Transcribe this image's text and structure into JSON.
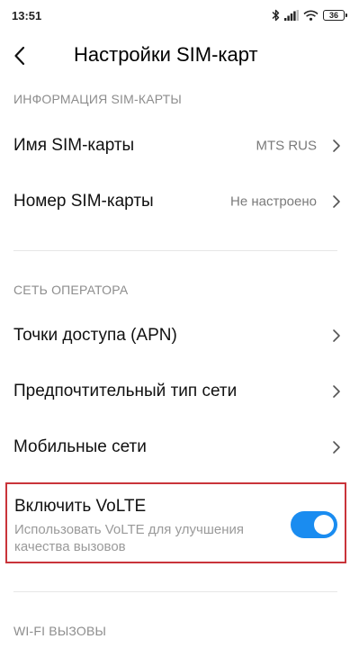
{
  "status_bar": {
    "time": "13:51",
    "battery_level": "36",
    "icons": [
      "bluetooth-icon",
      "signal-icon",
      "wifi-icon",
      "battery-icon"
    ]
  },
  "header": {
    "title": "Настройки SIM-карт",
    "back_icon": "back-arrow-icon"
  },
  "sections": {
    "sim_info": {
      "title": "ИНФОРМАЦИЯ SIM-КАРТЫ",
      "items": [
        {
          "label": "Имя SIM-карты",
          "value": "MTS RUS"
        },
        {
          "label": "Номер SIM-карты",
          "value": "Не настроено"
        }
      ]
    },
    "operator_network": {
      "title": "СЕТЬ ОПЕРАТОРА",
      "items": [
        {
          "label": "Точки доступа (APN)"
        },
        {
          "label": "Предпочтительный тип сети"
        },
        {
          "label": "Мобильные сети"
        }
      ]
    },
    "volte": {
      "title": "Включить VoLTE",
      "description": "Использовать VoLTE для улучшения качества вызовов",
      "enabled": true
    },
    "wifi_calls": {
      "title": "WI-FI ВЫЗОВЫ"
    }
  },
  "colors": {
    "accent": "#1a8cf0",
    "highlight_border": "#c9343a",
    "section_header": "#8d8d8d",
    "secondary_text": "#9a9a9a"
  }
}
